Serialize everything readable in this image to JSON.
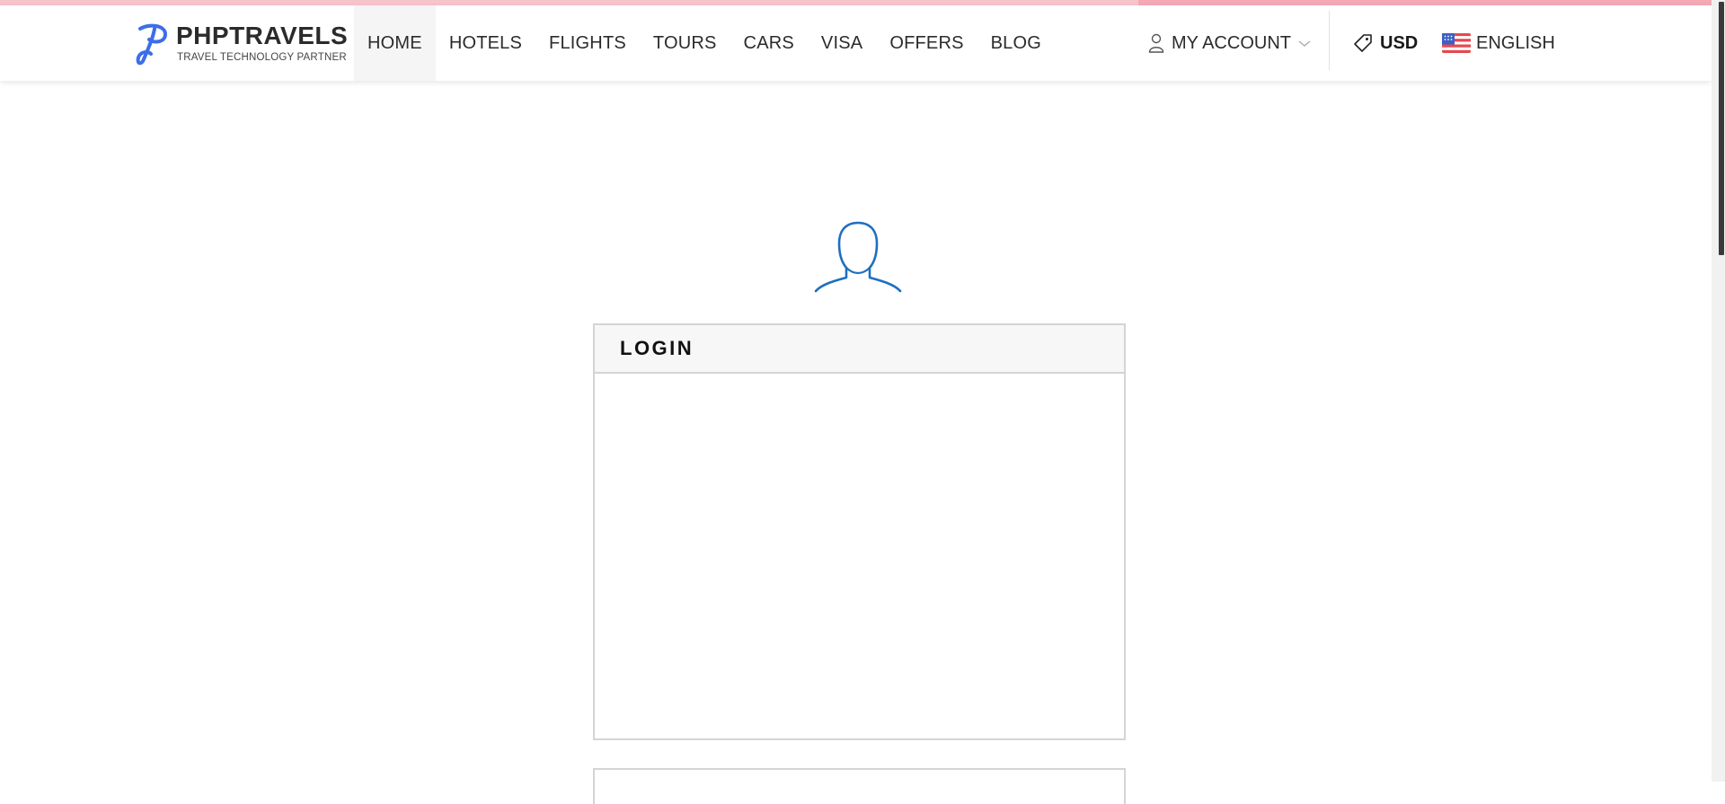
{
  "progress": {
    "fraction": 0.66,
    "track_color": "#f8c4cb",
    "fill_color": "#f4a9b4"
  },
  "logo": {
    "brand": "PHPTRAVELS",
    "tagline": "TRAVEL TECHNOLOGY PARTNER",
    "mark_color": "#3b6ee8"
  },
  "nav": {
    "items": [
      {
        "label": "HOME",
        "active": true
      },
      {
        "label": "HOTELS"
      },
      {
        "label": "FLIGHTS"
      },
      {
        "label": "TOURS"
      },
      {
        "label": "CARS"
      },
      {
        "label": "VISA"
      },
      {
        "label": "OFFERS"
      },
      {
        "label": "BLOG"
      }
    ]
  },
  "account": {
    "label": "MY ACCOUNT",
    "icon": "user-icon"
  },
  "currency": {
    "label": "USD",
    "icon": "tag-icon"
  },
  "language": {
    "label": "ENGLISH",
    "icon": "us-flag-icon"
  },
  "main": {
    "avatar_icon": "user-silhouette-icon",
    "avatar_color": "#1f6fbf",
    "login_panel": {
      "title": "LOGIN"
    }
  }
}
